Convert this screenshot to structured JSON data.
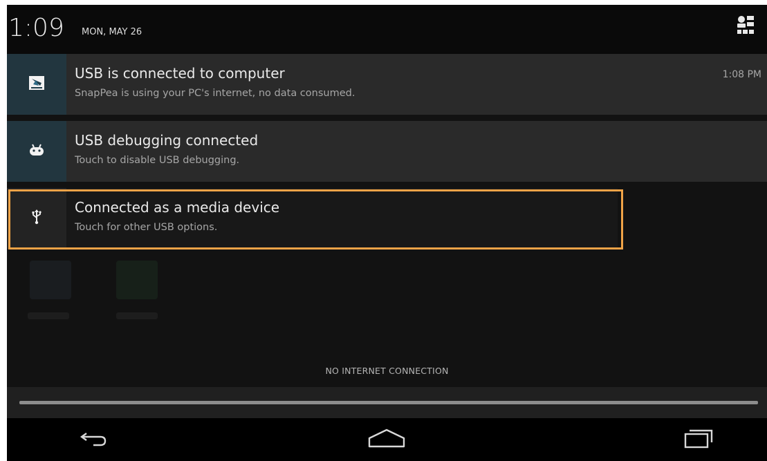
{
  "status_bar": {
    "time": "1:09",
    "date": "MON, MAY 26"
  },
  "notifications": [
    {
      "title": "USB is connected to computer",
      "subtitle": "SnapPea is using your PC's internet, no data consumed.",
      "time": "1:08 PM",
      "icon": "snappea-icon"
    },
    {
      "title": "USB debugging connected",
      "subtitle": "Touch to disable USB debugging.",
      "icon": "android-debug-icon"
    },
    {
      "title": "Connected as a media device",
      "subtitle": "Touch for other USB options.",
      "icon": "usb-icon"
    }
  ],
  "footer": {
    "status_text": "NO INTERNET CONNECTION"
  },
  "colors": {
    "highlight_border": "#f0a347",
    "icon_bg_blue": "#22363f"
  }
}
